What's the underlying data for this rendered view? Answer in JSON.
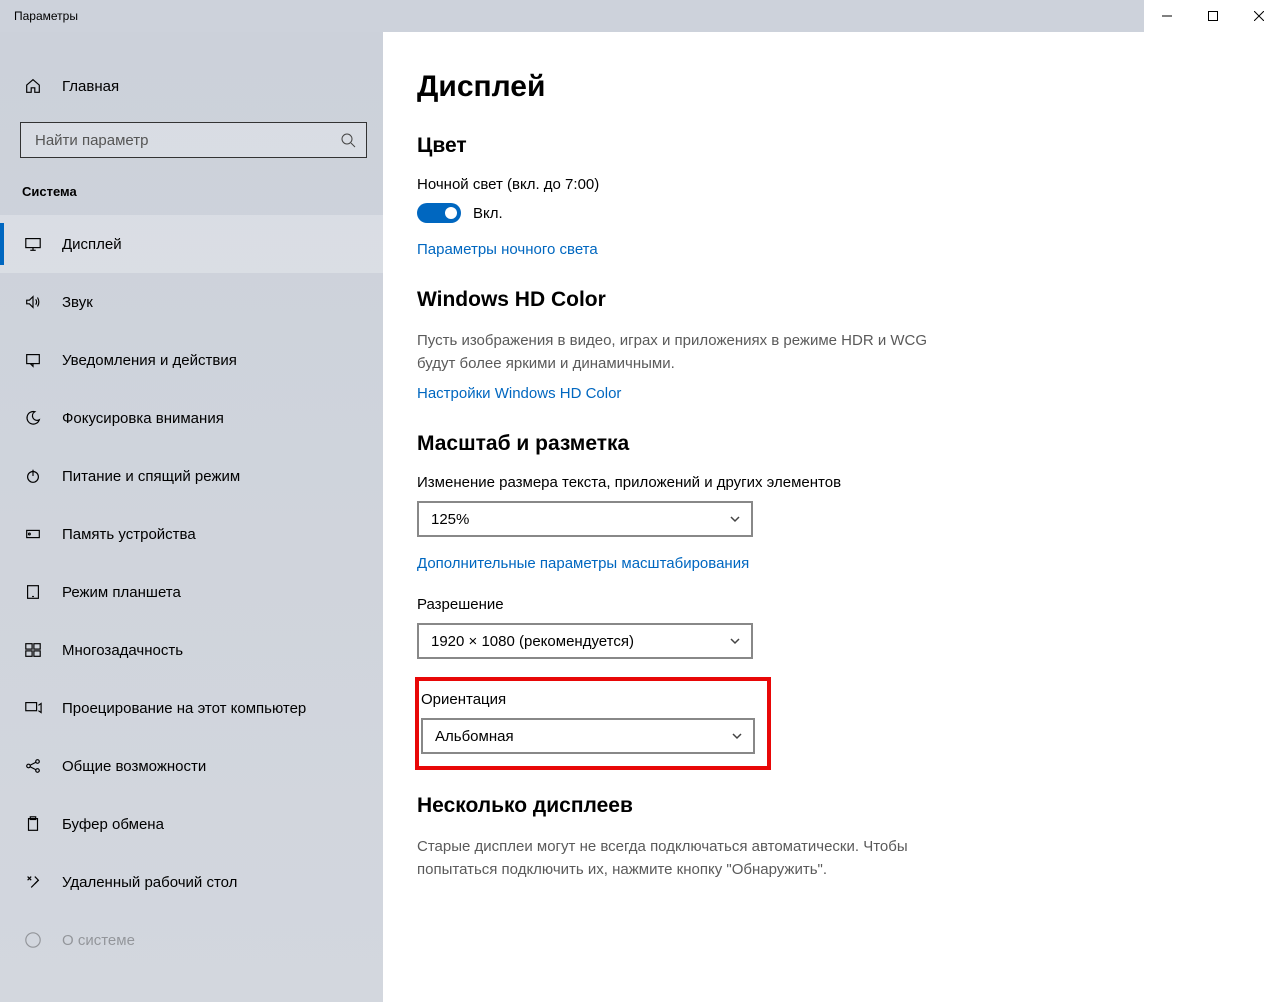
{
  "titlebar": {
    "title": "Параметры"
  },
  "sidebar": {
    "home": "Главная",
    "search_placeholder": "Найти параметр",
    "group": "Система",
    "items": [
      "Дисплей",
      "Звук",
      "Уведомления и действия",
      "Фокусировка внимания",
      "Питание и спящий режим",
      "Память устройства",
      "Режим планшета",
      "Многозадачность",
      "Проецирование на этот компьютер",
      "Общие возможности",
      "Буфер обмена",
      "Удаленный рабочий стол",
      "О системе"
    ]
  },
  "main": {
    "title": "Дисплей",
    "color_h": "Цвет",
    "night_label": "Ночной свет (вкл. до 7:00)",
    "toggle_on": "Вкл.",
    "night_link": "Параметры ночного света",
    "hd_h": "Windows HD Color",
    "hd_desc": "Пусть изображения в видео, играх и приложениях в режиме HDR и WCG будут более яркими и динамичными.",
    "hd_link": "Настройки Windows HD Color",
    "scale_h": "Масштаб и разметка",
    "scale_label": "Изменение размера текста, приложений и других элементов",
    "scale_value": "125%",
    "scale_link": "Дополнительные параметры масштабирования",
    "res_label": "Разрешение",
    "res_value": "1920 × 1080 (рекомендуется)",
    "orient_label": "Ориентация",
    "orient_value": "Альбомная",
    "multi_h": "Несколько дисплеев",
    "multi_desc": "Старые дисплеи могут не всегда подключаться автоматически. Чтобы попытаться подключить их, нажмите кнопку \"Обнаружить\"."
  }
}
